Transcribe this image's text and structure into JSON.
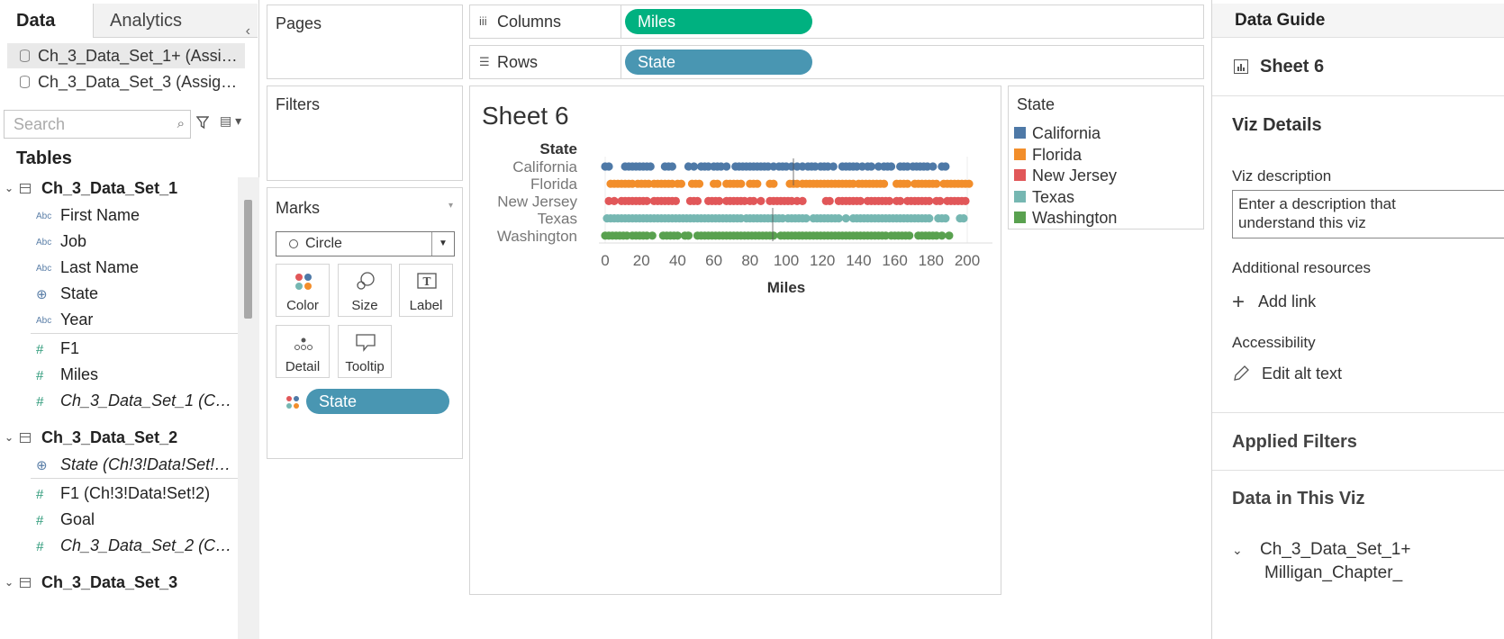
{
  "left_pane": {
    "tabs": [
      "Data",
      "Analytics"
    ],
    "collapse_icon": "chevron-left-icon",
    "data_sources": [
      "Ch_3_Data_Set_1+ (Assig…",
      "Ch_3_Data_Set_3 (Assign…"
    ],
    "search_placeholder": "Search",
    "tables_heading": "Tables",
    "tables": [
      {
        "name": "Ch_3_Data_Set_1",
        "fields": [
          {
            "type": "Abc",
            "name": "First Name"
          },
          {
            "type": "Abc",
            "name": "Job"
          },
          {
            "type": "Abc",
            "name": "Last Name"
          },
          {
            "type": "geo",
            "name": "State"
          },
          {
            "type": "Abc",
            "name": "Year"
          },
          {
            "type": "#",
            "name": "F1"
          },
          {
            "type": "#",
            "name": "Miles"
          },
          {
            "type": "#",
            "name": "Ch_3_Data_Set_1 (C…"
          }
        ]
      },
      {
        "name": "Ch_3_Data_Set_2",
        "fields": [
          {
            "type": "geo",
            "name": "State (Ch!3!Data!Set!…"
          },
          {
            "type": "#",
            "name": "F1 (Ch!3!Data!Set!2)"
          },
          {
            "type": "#",
            "name": "Goal"
          },
          {
            "type": "#",
            "name": "Ch_3_Data_Set_2 (C…"
          }
        ]
      },
      {
        "name": "Ch_3_Data_Set_3",
        "fields": []
      }
    ]
  },
  "cards": {
    "pages": "Pages",
    "filters": "Filters",
    "marks": {
      "title": "Marks",
      "mark_type": "Circle",
      "buttons": [
        "Color",
        "Size",
        "Label",
        "Detail",
        "Tooltip"
      ],
      "color_pill": "State"
    }
  },
  "shelves": {
    "columns": {
      "label": "Columns",
      "pill": "Miles"
    },
    "rows": {
      "label": "Rows",
      "pill": "State"
    }
  },
  "sheet": {
    "title": "Sheet 6"
  },
  "chart_data": {
    "type": "scatter",
    "row_header": "State",
    "categories": [
      "California",
      "Florida",
      "New Jersey",
      "Texas",
      "Washington"
    ],
    "xlabel": "Miles",
    "xlim": [
      0,
      200
    ],
    "xticks": [
      0,
      20,
      40,
      60,
      80,
      100,
      120,
      140,
      160,
      180,
      200
    ],
    "colors": [
      "#4e79a7",
      "#f28e2b",
      "#e15759",
      "#76b7b2",
      "#59a14f"
    ],
    "series": [
      {
        "name": "California",
        "values": [
          0,
          2,
          11,
          13,
          15,
          17,
          19,
          21,
          23,
          25,
          33,
          35,
          37,
          46,
          49,
          53,
          55,
          57,
          60,
          62,
          64,
          67,
          72,
          74,
          76,
          78,
          80,
          82,
          84,
          86,
          88,
          90,
          93,
          96,
          98,
          100,
          103,
          106,
          109,
          112,
          114,
          116,
          119,
          121,
          123,
          126,
          131,
          133,
          135,
          137,
          139,
          142,
          145,
          147,
          151,
          154,
          156,
          158,
          163,
          165,
          167,
          170,
          172,
          174,
          176,
          178,
          181,
          186,
          188
        ]
      },
      {
        "name": "Florida",
        "values": [
          3,
          5,
          7,
          9,
          11,
          13,
          15,
          18,
          20,
          22,
          24,
          27,
          29,
          31,
          33,
          35,
          37,
          40,
          42,
          48,
          50,
          52,
          60,
          62,
          67,
          69,
          71,
          73,
          75,
          80,
          82,
          84,
          91,
          93,
          102,
          104,
          106,
          109,
          111,
          113,
          115,
          117,
          119,
          121,
          123,
          125,
          127,
          129,
          131,
          133,
          135,
          137,
          140,
          142,
          144,
          146,
          148,
          150,
          152,
          154,
          161,
          163,
          165,
          167,
          171,
          173,
          175,
          177,
          179,
          181,
          183,
          187,
          189,
          191,
          193,
          195,
          197,
          199,
          201
        ]
      },
      {
        "name": "New Jersey",
        "values": [
          2,
          5,
          9,
          11,
          13,
          15,
          17,
          19,
          21,
          23,
          27,
          29,
          31,
          33,
          35,
          37,
          39,
          47,
          49,
          51,
          57,
          59,
          61,
          63,
          67,
          69,
          71,
          73,
          75,
          77,
          80,
          82,
          86,
          91,
          93,
          95,
          97,
          99,
          101,
          103,
          106,
          109,
          122,
          124,
          129,
          131,
          133,
          135,
          137,
          139,
          141,
          145,
          147,
          149,
          151,
          153,
          155,
          157,
          161,
          163,
          167,
          169,
          171,
          173,
          175,
          177,
          179,
          183,
          185,
          189,
          191,
          193,
          195,
          197,
          199
        ]
      },
      {
        "name": "Texas",
        "values": [
          1,
          3,
          5,
          7,
          9,
          11,
          13,
          15,
          17,
          19,
          21,
          23,
          25,
          27,
          29,
          31,
          33,
          35,
          37,
          39,
          41,
          43,
          45,
          47,
          49,
          51,
          53,
          55,
          57,
          59,
          61,
          63,
          65,
          67,
          69,
          71,
          73,
          75,
          78,
          80,
          82,
          84,
          86,
          88,
          90,
          92,
          94,
          96,
          98,
          101,
          103,
          105,
          107,
          109,
          111,
          115,
          117,
          119,
          121,
          123,
          125,
          127,
          129,
          133,
          137,
          139,
          141,
          143,
          145,
          147,
          149,
          151,
          153,
          155,
          157,
          159,
          161,
          163,
          165,
          167,
          169,
          171,
          173,
          175,
          177,
          179,
          184,
          186,
          188,
          196,
          198
        ]
      },
      {
        "name": "Washington",
        "values": [
          0,
          2,
          4,
          6,
          8,
          10,
          12,
          15,
          17,
          19,
          21,
          23,
          26,
          32,
          34,
          36,
          38,
          40,
          44,
          46,
          51,
          53,
          55,
          57,
          59,
          61,
          63,
          65,
          67,
          69,
          71,
          73,
          75,
          77,
          79,
          81,
          83,
          85,
          87,
          89,
          91,
          93,
          97,
          99,
          101,
          103,
          105,
          107,
          109,
          111,
          113,
          115,
          117,
          119,
          121,
          123,
          125,
          127,
          129,
          131,
          133,
          135,
          137,
          139,
          141,
          143,
          145,
          147,
          149,
          151,
          153,
          155,
          158,
          160,
          162,
          164,
          166,
          168,
          173,
          175,
          177,
          179,
          181,
          183,
          186,
          190
        ]
      }
    ],
    "legend_title": "State",
    "legend_placement": "right"
  },
  "legend": {
    "title": "State",
    "items": [
      "California",
      "Florida",
      "New Jersey",
      "Texas",
      "Washington"
    ]
  },
  "right_pane": {
    "header": "Data Guide",
    "sheet_name": "Sheet 6",
    "viz_details": "Viz Details",
    "viz_description_label": "Viz description",
    "viz_description_line1": "Enter a description that",
    "viz_description_line2": "understand this viz",
    "additional_resources": "Additional resources",
    "add_link": "Add link",
    "accessibility": "Accessibility",
    "edit_alt_text": "Edit alt text",
    "applied_filters": "Applied Filters",
    "data_in_viz": "Data in This Viz",
    "data_item_line1": "Ch_3_Data_Set_1+",
    "data_item_line2": "Milligan_Chapter_"
  }
}
